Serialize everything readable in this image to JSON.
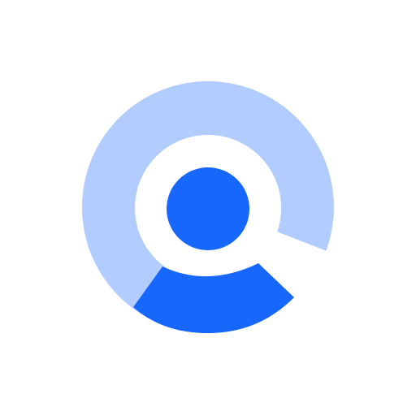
{
  "logo": {
    "icon": "user-search-icon",
    "colors": {
      "background": "#ffffff",
      "ring": "#b2cdfd",
      "primary": "#1767fb"
    }
  }
}
